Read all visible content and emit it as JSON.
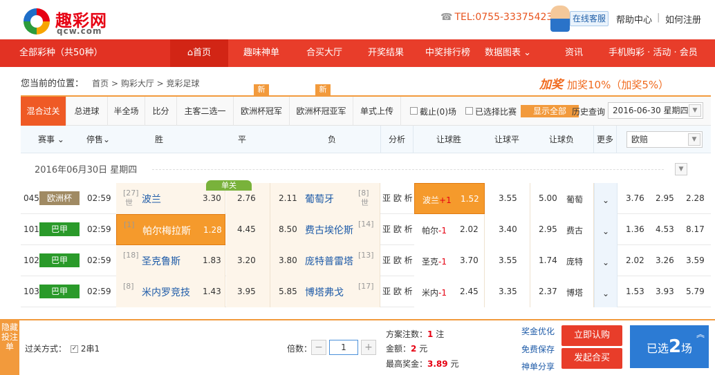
{
  "header": {
    "brand": "趣彩网",
    "domain": "qcw.com",
    "tel": "TEL:0755-33375423",
    "service": "在线客服",
    "help": "帮助中心",
    "register": "如何注册",
    "sep": "|"
  },
  "nav": {
    "all": "全部彩种（共50种）",
    "items": [
      "首页",
      "趣味神单",
      "合买大厅",
      "开奖结果",
      "中奖排行榜",
      "数据图表",
      "资讯",
      "手机购彩 · 活动 · 会员"
    ]
  },
  "breadcrumb": {
    "label": "您当前的位置：",
    "path": "首页 > 购彩大厅 > 竞彩足球"
  },
  "promo": {
    "tag": "加奖",
    "text": "加奖10%（加奖5%）"
  },
  "tabs": {
    "items": [
      "混合过关",
      "总进球",
      "半全场",
      "比分",
      "主客二选一",
      "欧洲杯冠军",
      "欧洲杯冠亚军",
      "单式上传"
    ],
    "new_badge": "新",
    "cutoff": "截止(0)场",
    "chosen": "已选择比赛",
    "show_all": "显示全部",
    "history": "历史查询",
    "date": "2016-06-30 星期四"
  },
  "columns": {
    "event": "赛事",
    "stop": "停售",
    "win": "胜",
    "draw": "平",
    "lose": "负",
    "analysis": "分析",
    "hwin": "让球胜",
    "hdraw": "让球平",
    "hlose": "让球负",
    "more": "更多",
    "odds_type": "欧赔"
  },
  "date_row": "2016年06月30日 星期四",
  "single_badge": "单关",
  "matches": [
    {
      "no": "045",
      "league": "欧洲杯",
      "league_color": "#a08a63",
      "time": "02:59",
      "home_rank": "[27]",
      "home_rank2": "世",
      "home": "波兰",
      "win": "3.30",
      "draw": "2.76",
      "lose": "2.11",
      "away": "葡萄牙",
      "away_rank": "[8]",
      "away_rank2": "世",
      "analysis": "亚 欧 析",
      "h_team": "波兰",
      "h_line": "+1",
      "h_win": "1.52",
      "h_draw": "3.55",
      "h_lose": "5.00",
      "h_away": "葡萄",
      "eu": [
        "3.76",
        "2.95",
        "2.28"
      ]
    },
    {
      "no": "101",
      "league": "巴甲",
      "league_color": "#2a9a2a",
      "time": "02:59",
      "home_rank": "[1]",
      "home_rank2": "",
      "home": "帕尔梅拉斯",
      "win": "1.28",
      "draw": "4.45",
      "lose": "8.50",
      "away": "费古埃伦斯",
      "away_rank": "[14]",
      "away_rank2": "",
      "analysis": "亚 欧 析",
      "h_team": "帕尔",
      "h_line": "-1",
      "h_win": "2.02",
      "h_draw": "3.40",
      "h_lose": "2.95",
      "h_away": "费古",
      "eu": [
        "1.36",
        "4.53",
        "8.17"
      ]
    },
    {
      "no": "102",
      "league": "巴甲",
      "league_color": "#2a9a2a",
      "time": "02:59",
      "home_rank": "[18]",
      "home_rank2": "",
      "home": "圣克鲁斯",
      "win": "1.83",
      "draw": "3.20",
      "lose": "3.80",
      "away": "庞特普雷塔",
      "away_rank": "[13]",
      "away_rank2": "",
      "analysis": "亚 欧 析",
      "h_team": "圣克",
      "h_line": "-1",
      "h_win": "3.70",
      "h_draw": "3.55",
      "h_lose": "1.74",
      "h_away": "庞特",
      "eu": [
        "2.02",
        "3.26",
        "3.59"
      ]
    },
    {
      "no": "103",
      "league": "巴甲",
      "league_color": "#2a9a2a",
      "time": "02:59",
      "home_rank": "[8]",
      "home_rank2": "",
      "home": "米内罗竞技",
      "win": "1.43",
      "draw": "3.95",
      "lose": "5.85",
      "away": "博塔弗戈",
      "away_rank": "[17]",
      "away_rank2": "",
      "analysis": "亚 欧 析",
      "h_team": "米内",
      "h_line": "-1",
      "h_win": "2.45",
      "h_draw": "3.35",
      "h_lose": "2.37",
      "h_away": "博塔",
      "eu": [
        "1.53",
        "3.93",
        "5.79"
      ]
    }
  ],
  "bottom": {
    "side": "隐藏投注单",
    "pass_label": "过关方式：",
    "pass_option": "2串1",
    "mult_label": "倍数：",
    "mult_value": "1",
    "bets_label": "方案注数：",
    "bets_value": "1",
    "bets_unit": "注",
    "amount_label": "金额：",
    "amount_value": "2",
    "amount_unit": "元",
    "max_label": "最高奖金：",
    "max_value": "3.89",
    "max_unit": "元",
    "links": [
      "奖金优化",
      "免费保存",
      "神单分享"
    ],
    "buy": "立即认购",
    "group": "发起合买",
    "selected_pre": "已选",
    "selected_count": "2",
    "selected_post": "场"
  },
  "colors": {
    "brand_red": "#e83d2a",
    "orange": "#f29a3c",
    "select": "#f59a2c",
    "blue": "#2c7bd4"
  }
}
